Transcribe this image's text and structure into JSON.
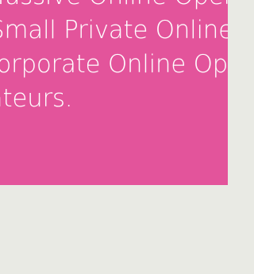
{
  "hero": {
    "lines": [
      "Massive Online Open C",
      "Small Private Online Co",
      "Corporate Online Open",
      "Amateurs."
    ],
    "background_color": "#e3549b",
    "text_color": "#ffffff"
  },
  "page": {
    "background_color": "#e9eae4"
  }
}
